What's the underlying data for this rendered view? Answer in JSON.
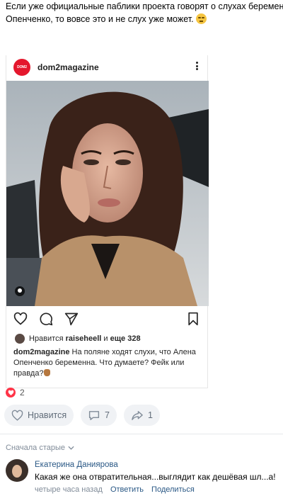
{
  "post": {
    "text_line1": "Если уже официальные паблики проекта говорят о слухах беременност",
    "text_line2": "Опенченко, то вовсе это и не слух уже может. "
  },
  "embed": {
    "avatar_text": "DOM2",
    "username": "dom2magazine",
    "likes_prefix": "Нравится ",
    "likes_user": "raiseheell",
    "likes_and": " и ",
    "likes_more": "еще 328",
    "caption_user": "dom2magazine",
    "caption_text": " На поляне ходят слухи, что Алена Опенченко беременна. Что думаете? Фейк или правда?"
  },
  "reactions": {
    "count": "2"
  },
  "actions": {
    "like_label": "Нравится",
    "comments_count": "7",
    "share_count": "1"
  },
  "comments": {
    "sort_label": "Сначала старые",
    "items": [
      {
        "author": "Екатерина Даниярова",
        "text": "Какая же она отвратительная...выглядит как дешёвая шл...а!",
        "time": "четыре часа назад",
        "reply_label": "Ответить",
        "share_label": "Поделиться"
      }
    ]
  },
  "colors": {
    "brand_red": "#e4172d",
    "link_blue": "#2a5885",
    "button_bg": "#f0f2f5",
    "heart": "#ff3347"
  }
}
